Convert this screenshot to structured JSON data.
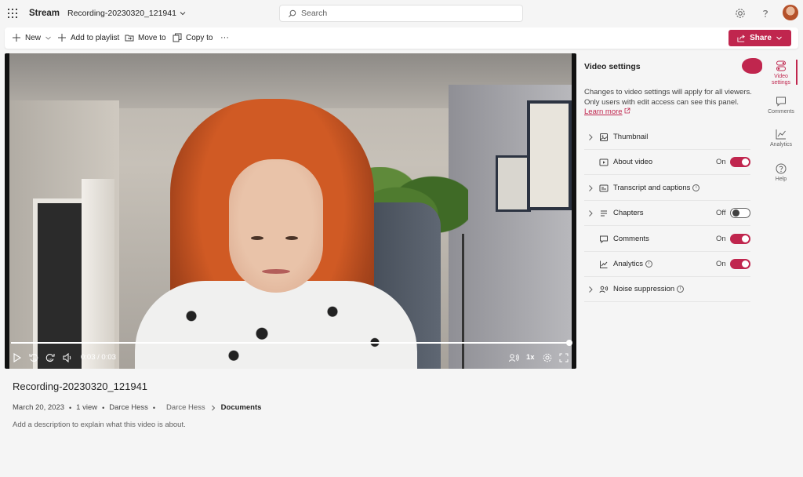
{
  "app": {
    "name": "Stream",
    "file_title": "Recording-20230320_121941"
  },
  "search": {
    "placeholder": "Search"
  },
  "toolbar": {
    "new_label": "New",
    "add_to_playlist_label": "Add to playlist",
    "move_to_label": "Move to",
    "copy_to_label": "Copy to",
    "more_label": "···",
    "share_label": "Share"
  },
  "player": {
    "time_display": "0:03 / 0:03",
    "speed": "1x",
    "progress_fraction": 1.0
  },
  "video": {
    "title": "Recording-20230320_121941",
    "date": "March 20, 2023",
    "views": "1 view",
    "author": "Darce Hess",
    "breadcrumb_owner": "Darce Hess",
    "breadcrumb_folder": "Documents",
    "description_placeholder": "Add a description to explain what this video is about."
  },
  "settings_panel": {
    "title": "Video settings",
    "note_text": "Changes to video settings will apply for all viewers. Only users with edit access can see this panel.",
    "note_link": "Learn more",
    "rows": [
      {
        "label": "Thumbnail",
        "expandable": true,
        "state": "",
        "toggle": null,
        "info": false
      },
      {
        "label": "About video",
        "expandable": false,
        "state": "On",
        "toggle": true,
        "info": false
      },
      {
        "label": "Transcript and captions",
        "expandable": true,
        "state": "",
        "toggle": null,
        "info": true
      },
      {
        "label": "Chapters",
        "expandable": true,
        "state": "Off",
        "toggle": false,
        "info": false
      },
      {
        "label": "Comments",
        "expandable": false,
        "state": "On",
        "toggle": true,
        "info": false
      },
      {
        "label": "Analytics",
        "expandable": false,
        "state": "On",
        "toggle": true,
        "info": true
      },
      {
        "label": "Noise suppression",
        "expandable": true,
        "state": "",
        "toggle": null,
        "info": true
      }
    ]
  },
  "right_rail": {
    "video_settings_label": "Video settings",
    "comments_label": "Comments",
    "analytics_label": "Analytics",
    "help_label": "Help"
  },
  "colors": {
    "accent": "#c0264e",
    "background": "#f5f5f5",
    "video_bg": "#111111"
  },
  "icons": [
    "waffle-icon",
    "search-icon",
    "gear-icon",
    "help-icon",
    "plus-icon",
    "chevron-down-icon",
    "playlist-icon",
    "folder-move-icon",
    "copy-icon",
    "share-icon",
    "play-icon",
    "rewind-icon",
    "forward-icon",
    "volume-icon",
    "captions-icon",
    "settings-icon",
    "fullscreen-icon",
    "image-icon",
    "video-icon",
    "transcript-icon",
    "list-icon",
    "comment-icon",
    "chart-icon",
    "noise-icon",
    "external-link-icon"
  ]
}
